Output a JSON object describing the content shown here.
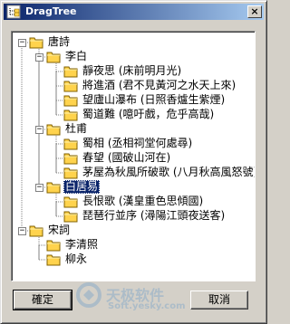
{
  "window": {
    "title": "DragTree",
    "close_glyph": "×"
  },
  "tree": [
    {
      "label": "唐詩",
      "expanded": true,
      "children": [
        {
          "label": "李白",
          "expanded": true,
          "children": [
            {
              "label": "靜夜思 (床前明月光)"
            },
            {
              "label": "將進酒 (君不見黃河之水天上來)"
            },
            {
              "label": "望廬山瀑布 (日照香爐生紫煙)"
            },
            {
              "label": "蜀道難 (噫吁戲，危乎高哉)"
            }
          ]
        },
        {
          "label": "杜甫",
          "expanded": true,
          "children": [
            {
              "label": "蜀相 (丞相祠堂何處尋)"
            },
            {
              "label": "春望 (國破山河在)"
            },
            {
              "label": "茅屋為秋風所破歌 (八月秋高風怒號)"
            }
          ]
        },
        {
          "label": "白居易",
          "expanded": true,
          "selected": true,
          "children": [
            {
              "label": "長恨歌 (漢皇重色思傾國)"
            },
            {
              "label": "琵琶行並序 (潯陽江頭夜送客)"
            }
          ]
        }
      ]
    },
    {
      "label": "宋詞",
      "expanded": true,
      "children": [
        {
          "label": "李清照"
        },
        {
          "label": "柳永"
        }
      ]
    }
  ],
  "buttons": {
    "ok": "確定",
    "cancel": "取消"
  },
  "watermark": {
    "line1": "天极软件",
    "line2": "Soft.yesky.com"
  },
  "colors": {
    "title_start": "#0a246a",
    "title_end": "#a6caf0",
    "selection": "#0a246a",
    "folder": "#ffd34d"
  }
}
